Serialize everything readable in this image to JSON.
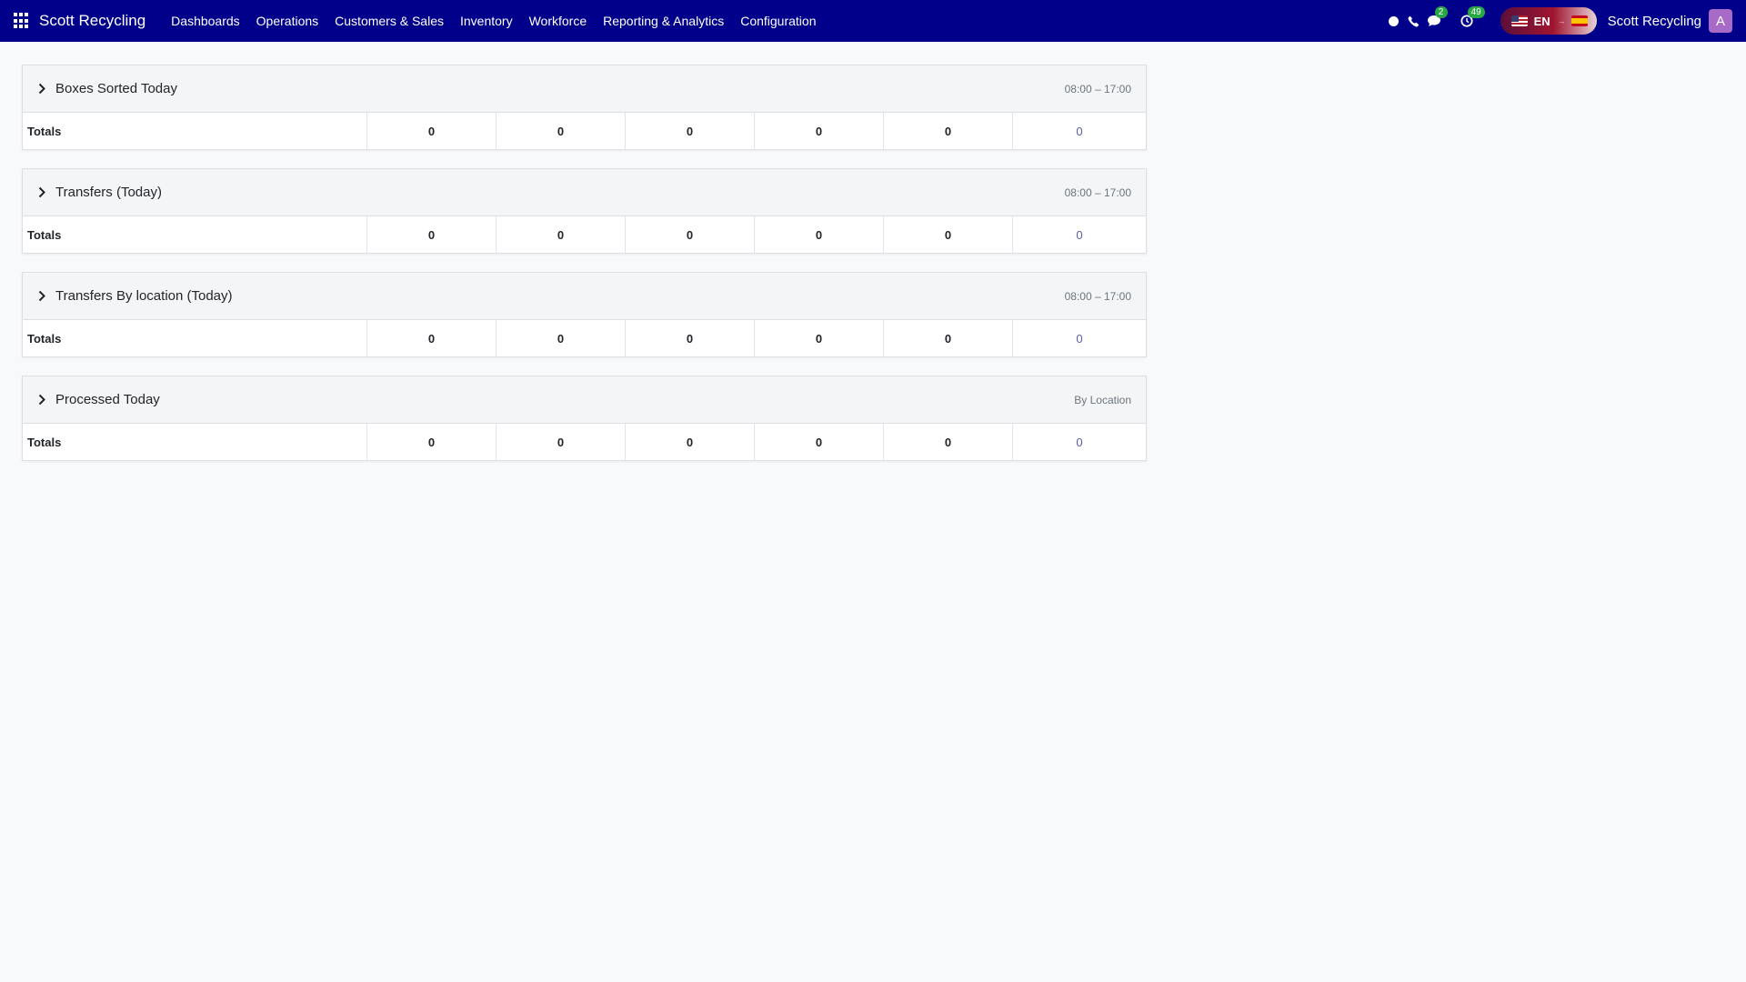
{
  "navbar": {
    "brand": "Scott Recycling",
    "menu": [
      "Dashboards",
      "Operations",
      "Customers & Sales",
      "Inventory",
      "Workforce",
      "Reporting & Analytics",
      "Configuration"
    ],
    "chat_badge": "2",
    "activity_badge": "49",
    "language": "EN",
    "company": "Scott Recycling",
    "avatar_letter": "A"
  },
  "cards": [
    {
      "title": "Boxes Sorted Today",
      "meta": "08:00 – 17:00",
      "row_label": "Totals",
      "values": [
        "0",
        "0",
        "0",
        "0",
        "0",
        "0"
      ]
    },
    {
      "title": "Transfers (Today)",
      "meta": "08:00 – 17:00",
      "row_label": "Totals",
      "values": [
        "0",
        "0",
        "0",
        "0",
        "0",
        "0"
      ]
    },
    {
      "title": "Transfers By location (Today)",
      "meta": "08:00 – 17:00",
      "row_label": "Totals",
      "values": [
        "0",
        "0",
        "0",
        "0",
        "0",
        "0"
      ]
    },
    {
      "title": "Processed Today",
      "meta": "By Location",
      "row_label": "Totals",
      "values": [
        "0",
        "0",
        "0",
        "0",
        "0",
        "0"
      ]
    }
  ],
  "colors": {
    "navbar": "#00008b",
    "avatar": "#a86ac7",
    "badge": "#28a745",
    "link_value": "#5a5ea8"
  }
}
